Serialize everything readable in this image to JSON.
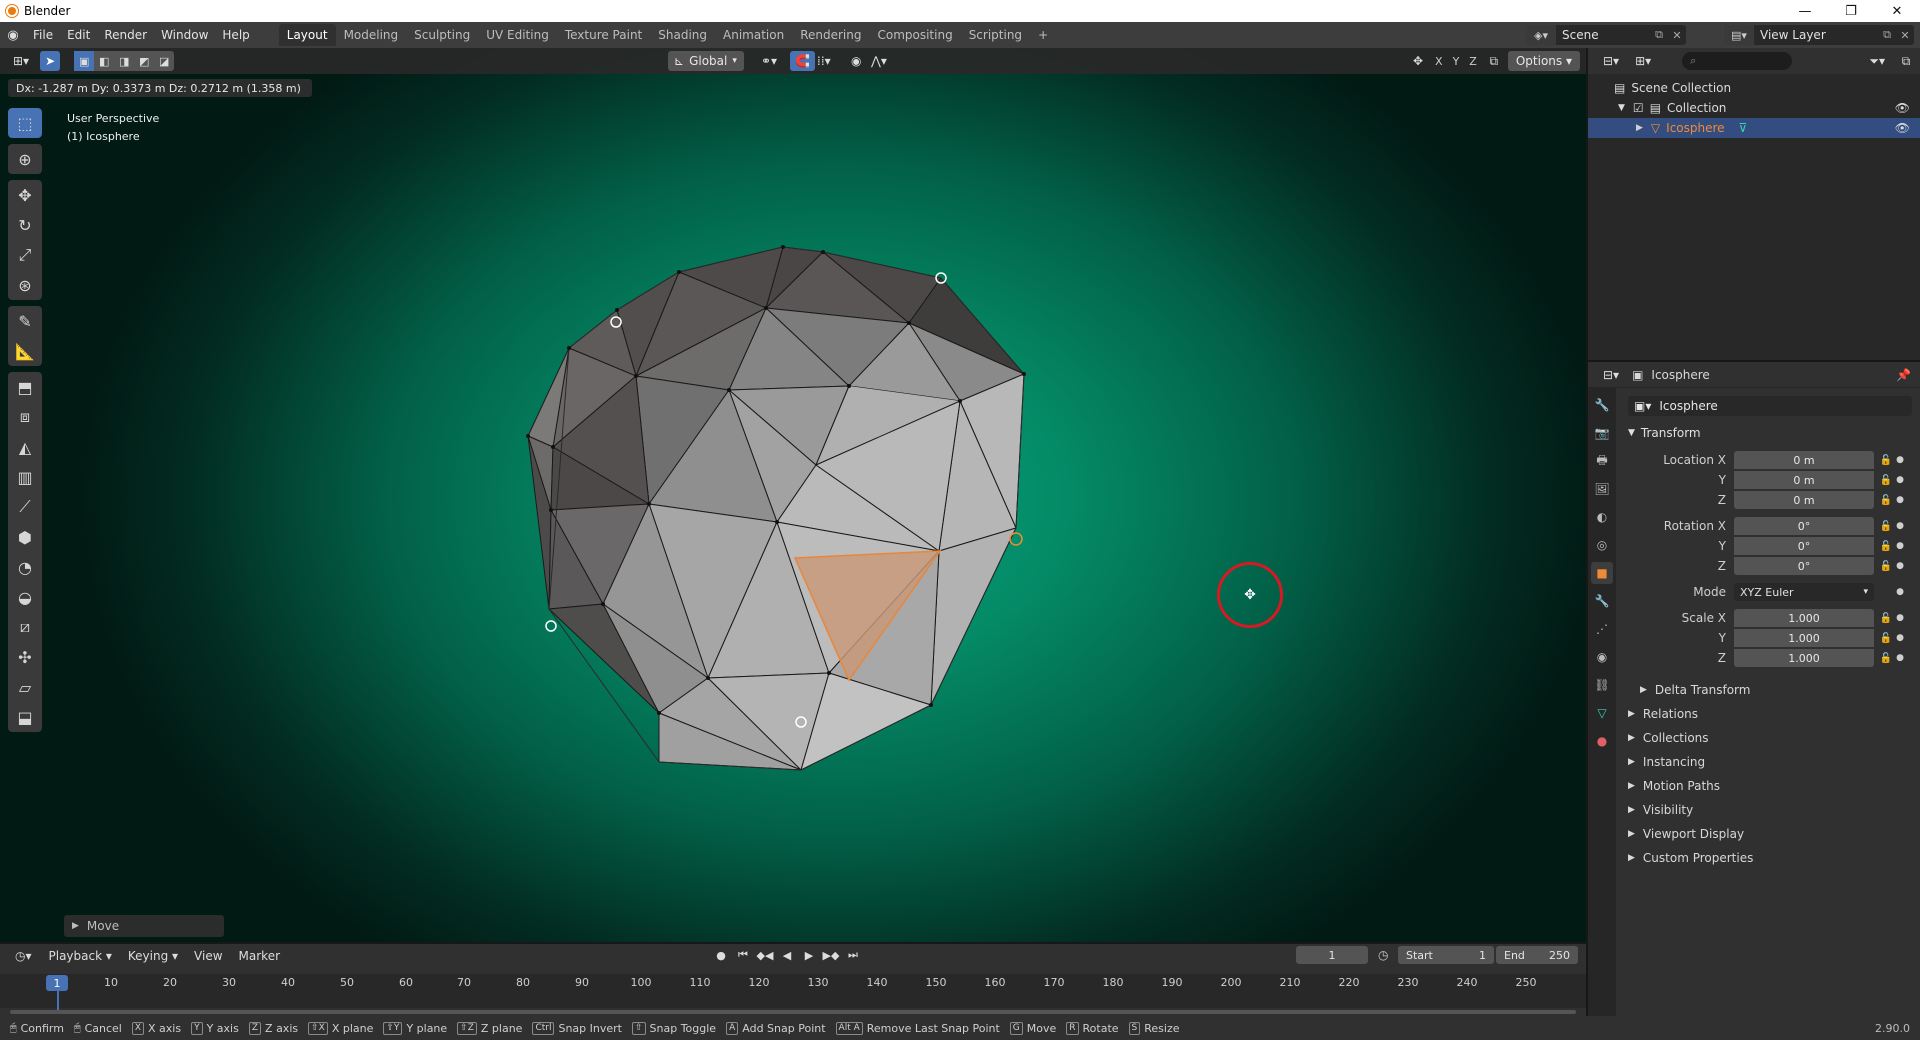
{
  "window": {
    "title": "Blender",
    "controls": [
      "—",
      "❐",
      "✕"
    ]
  },
  "menu": [
    "File",
    "Edit",
    "Render",
    "Window",
    "Help"
  ],
  "workspaces": [
    {
      "label": "Layout",
      "active": true
    },
    {
      "label": "Modeling"
    },
    {
      "label": "Sculpting"
    },
    {
      "label": "UV Editing"
    },
    {
      "label": "Texture Paint"
    },
    {
      "label": "Shading"
    },
    {
      "label": "Animation"
    },
    {
      "label": "Rendering"
    },
    {
      "label": "Compositing"
    },
    {
      "label": "Scripting"
    }
  ],
  "scene": {
    "name": "Scene"
  },
  "view_layer": {
    "name": "View Layer"
  },
  "viewport": {
    "orientation": "Global",
    "axes": [
      "X",
      "Y",
      "Z"
    ],
    "options_label": "Options",
    "status_overlay": "Dx: -1.287 m  Dy: 0.3373 m  Dz: 0.2712 m (1.358 m)",
    "perspective_label": "User Perspective",
    "object_label": "(1) Icosphere",
    "last_op_label": "Move",
    "accent": "#4772b3",
    "selection_color": "#f08a36"
  },
  "outliner": {
    "rows": [
      {
        "label": "Scene Collection"
      },
      {
        "label": "Collection"
      },
      {
        "label": "Icosphere",
        "selected": true
      }
    ]
  },
  "properties": {
    "header_object": "Icosphere",
    "name_field": "Icosphere",
    "transform_title": "Transform",
    "location": {
      "label_x": "Location X",
      "x": "0 m",
      "y": "0 m",
      "z": "0 m"
    },
    "rotation": {
      "label_x": "Rotation X",
      "x": "0°",
      "y": "0°",
      "z": "0°"
    },
    "mode": {
      "label": "Mode",
      "value": "XYZ Euler"
    },
    "scale": {
      "label_x": "Scale X",
      "x": "1.000",
      "y": "1.000",
      "z": "1.000"
    },
    "axis_y": "Y",
    "axis_z": "Z",
    "delta_transform": "Delta Transform",
    "panels": [
      "Relations",
      "Collections",
      "Instancing",
      "Motion Paths",
      "Visibility",
      "Viewport Display",
      "Custom Properties"
    ]
  },
  "timeline": {
    "menus": [
      "Playback",
      "Keying",
      "View",
      "Marker"
    ],
    "current_frame": "1",
    "start_label": "Start",
    "start": "1",
    "end_label": "End",
    "end": "250",
    "ticks": [
      "10",
      "20",
      "30",
      "40",
      "50",
      "60",
      "70",
      "80",
      "90",
      "100",
      "110",
      "120",
      "130",
      "140",
      "150",
      "160",
      "170",
      "180",
      "190",
      "200",
      "210",
      "220",
      "230",
      "240",
      "250"
    ]
  },
  "statusbar": {
    "items": [
      {
        "key": "",
        "label": "Confirm"
      },
      {
        "key": "",
        "label": "Cancel"
      },
      {
        "key": "X",
        "label": "X axis"
      },
      {
        "key": "Y",
        "label": "Y axis"
      },
      {
        "key": "Z",
        "label": "Z axis"
      },
      {
        "key": "⇧X",
        "label": "X plane"
      },
      {
        "key": "⇧Y",
        "label": "Y plane"
      },
      {
        "key": "⇧Z",
        "label": "Z plane"
      },
      {
        "key": "Ctrl",
        "label": "Snap Invert"
      },
      {
        "key": "⇧",
        "label": "Snap Toggle"
      },
      {
        "key": "A",
        "label": "Add Snap Point"
      },
      {
        "key": "Alt A",
        "label": "Remove Last Snap Point"
      },
      {
        "key": "G",
        "label": "Move"
      },
      {
        "key": "R",
        "label": "Rotate"
      },
      {
        "key": "S",
        "label": "Resize"
      }
    ],
    "version": "2.90.0"
  }
}
